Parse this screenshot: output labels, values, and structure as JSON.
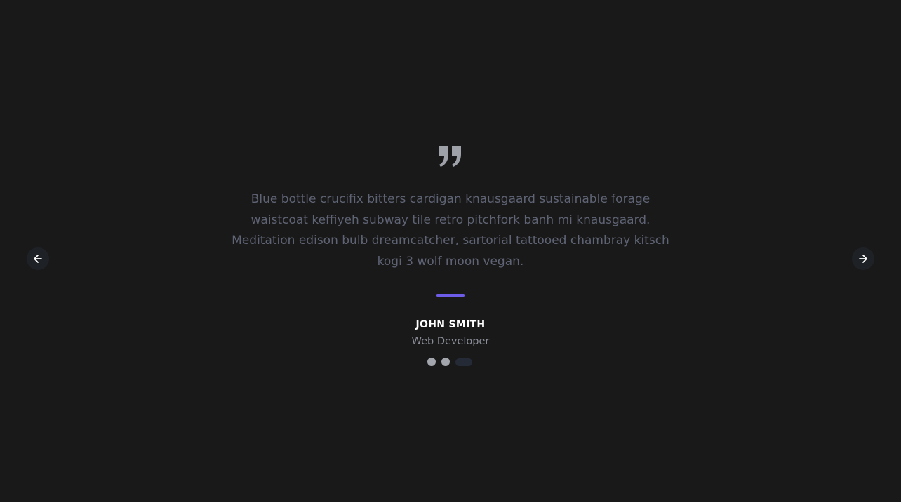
{
  "testimonial": {
    "quote": "Blue bottle crucifix bitters cardigan knausgaard sustainable forage waistcoat keffiyeh subway tile retro pitchfork banh mi knausgaard. Meditation edison bulb dreamcatcher, sartorial tattooed chambray kitsch kogi 3 wolf moon vegan.",
    "author_name": "JOHN SMITH",
    "author_role": "Web Developer",
    "quote_icon": "quote-icon"
  },
  "slider": {
    "total_slides": 3,
    "active_index": 2,
    "prev_icon": "arrow-left-icon",
    "next_icon": "arrow-right-icon"
  },
  "colors": {
    "background": "#191919",
    "accent": "#6c5ce7",
    "quote_text": "#5f6475",
    "dot_inactive": "#a3a6ad",
    "dot_active": "#242a36"
  }
}
